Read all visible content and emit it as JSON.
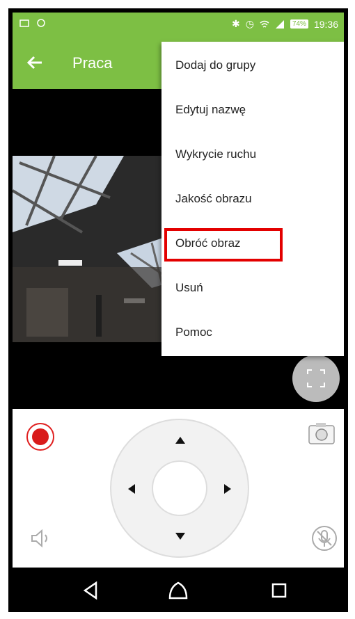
{
  "status_bar": {
    "time": "19:36",
    "battery": "74%"
  },
  "toolbar": {
    "title": "Praca"
  },
  "menu": {
    "items": [
      {
        "label": "Dodaj do grupy"
      },
      {
        "label": "Edytuj nazwę"
      },
      {
        "label": "Wykrycie ruchu"
      },
      {
        "label": "Jakość obrazu"
      },
      {
        "label": "Obróć obraz"
      },
      {
        "label": "Usuń"
      },
      {
        "label": "Pomoc"
      }
    ],
    "highlighted_index": 4
  },
  "colors": {
    "toolbar": "#7dbf44",
    "record": "#d91a1a",
    "highlight_box": "#e30000"
  },
  "icons": {
    "back": "back-arrow-icon",
    "fullscreen": "fullscreen-icon",
    "record": "record-icon",
    "snapshot": "camera-icon",
    "speaker": "speaker-icon",
    "microphone": "microphone-off-icon",
    "nav_back": "nav-back-icon",
    "nav_home": "nav-home-icon",
    "nav_recent": "nav-recent-icon"
  }
}
